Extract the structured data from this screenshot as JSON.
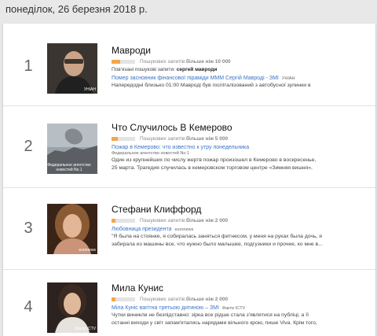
{
  "header": {
    "date": "понеділок, 26 березня 2018 р."
  },
  "items": [
    {
      "rank": "1",
      "thumb_caption": "УНІАН",
      "title": "Мавроди",
      "metric_label": "Пошукових запитів: ",
      "metric_value": "більше ніж 10 000",
      "metric_fraction": 0.35,
      "related_label": "Пов'язані пошукові запити: ",
      "related_value": "сергей мавроди",
      "news_title": "Помер засновник фінансової піраміди МММ Сергій Мавроді - ЗМІ",
      "news_source": "УНІАН",
      "snippet_lines": [
        "Напередодні близько 01:00 Мавроді був госпіталізований з автобусної зупинки в"
      ]
    },
    {
      "rank": "2",
      "thumb_caption": "Федеральное агентство новостей No.1",
      "title": "Что Случилось В Кемерово",
      "metric_label": "Пошукових запитів: ",
      "metric_value": "більше ніж 5 000",
      "metric_fraction": 0.25,
      "news_title": "Пожар в Кемерово: что известно к утру понедельника",
      "news_source": "Федеральное агентство новостей No.1",
      "snippet_lines": [
        "Один из крупнейших по числу жертв пожар произошел в Кемерово в воскресенье,",
        "25 марта. Трагедия случилась в кемеровском торговом центре «Зимняя вишня»,"
      ]
    },
    {
      "rank": "3",
      "thumb_caption": "euronews",
      "title": "Стефани Клиффорд",
      "metric_label": "Пошукових запитів: ",
      "metric_value": "більше ніж 2 000",
      "metric_fraction": 0.15,
      "news_title": "Любовница президента",
      "news_source": "euronews",
      "snippet_lines": [
        "\"Я была на стоянке, я собиралась заняться фитнесом, у меня на руках была дочь, я",
        "забирала из машины все, что нужно было малышке, подгузники и прочее, ко мне в..."
      ]
    },
    {
      "rank": "4",
      "thumb_caption": "Факти ICTV",
      "title": "Мила Кунис",
      "metric_label": "Пошукових запитів: ",
      "metric_value": "більше ніж 2 000",
      "metric_fraction": 0.15,
      "news_title": "Міла Куніс вагітна третьою дитиною – ЗМІ",
      "news_source": "Факти ICTV",
      "snippet_lines": [
        "Чутки виникли не безпідставно: зірка все рідше стала з'являтися на публіці, а її",
        "останні виходи у світ запам'ятались нарядами вільного крою, пише Viva. Крім того,"
      ]
    }
  ]
}
